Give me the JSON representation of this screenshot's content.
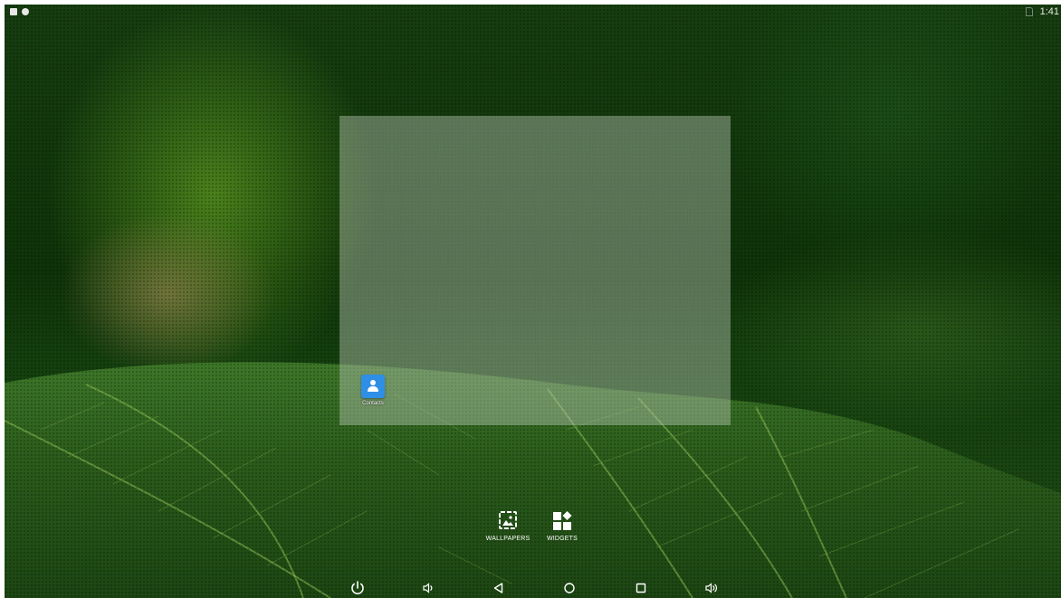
{
  "status_bar": {
    "time": "1:41",
    "left_icons": [
      "notification-icon",
      "notification-icon"
    ],
    "right_icons": [
      "no-sim-icon"
    ]
  },
  "workspace": {
    "apps": [
      {
        "label": "Contacts",
        "icon": "contacts-icon",
        "color": "#2f8fe6"
      }
    ]
  },
  "overview_options": {
    "wallpapers_label": "WALLPAPERS",
    "widgets_label": "WIDGETS"
  },
  "navigation_bar": {
    "buttons": [
      "power-icon",
      "volume-down-icon",
      "back-icon",
      "home-icon",
      "recents-icon",
      "volume-up-icon"
    ]
  }
}
